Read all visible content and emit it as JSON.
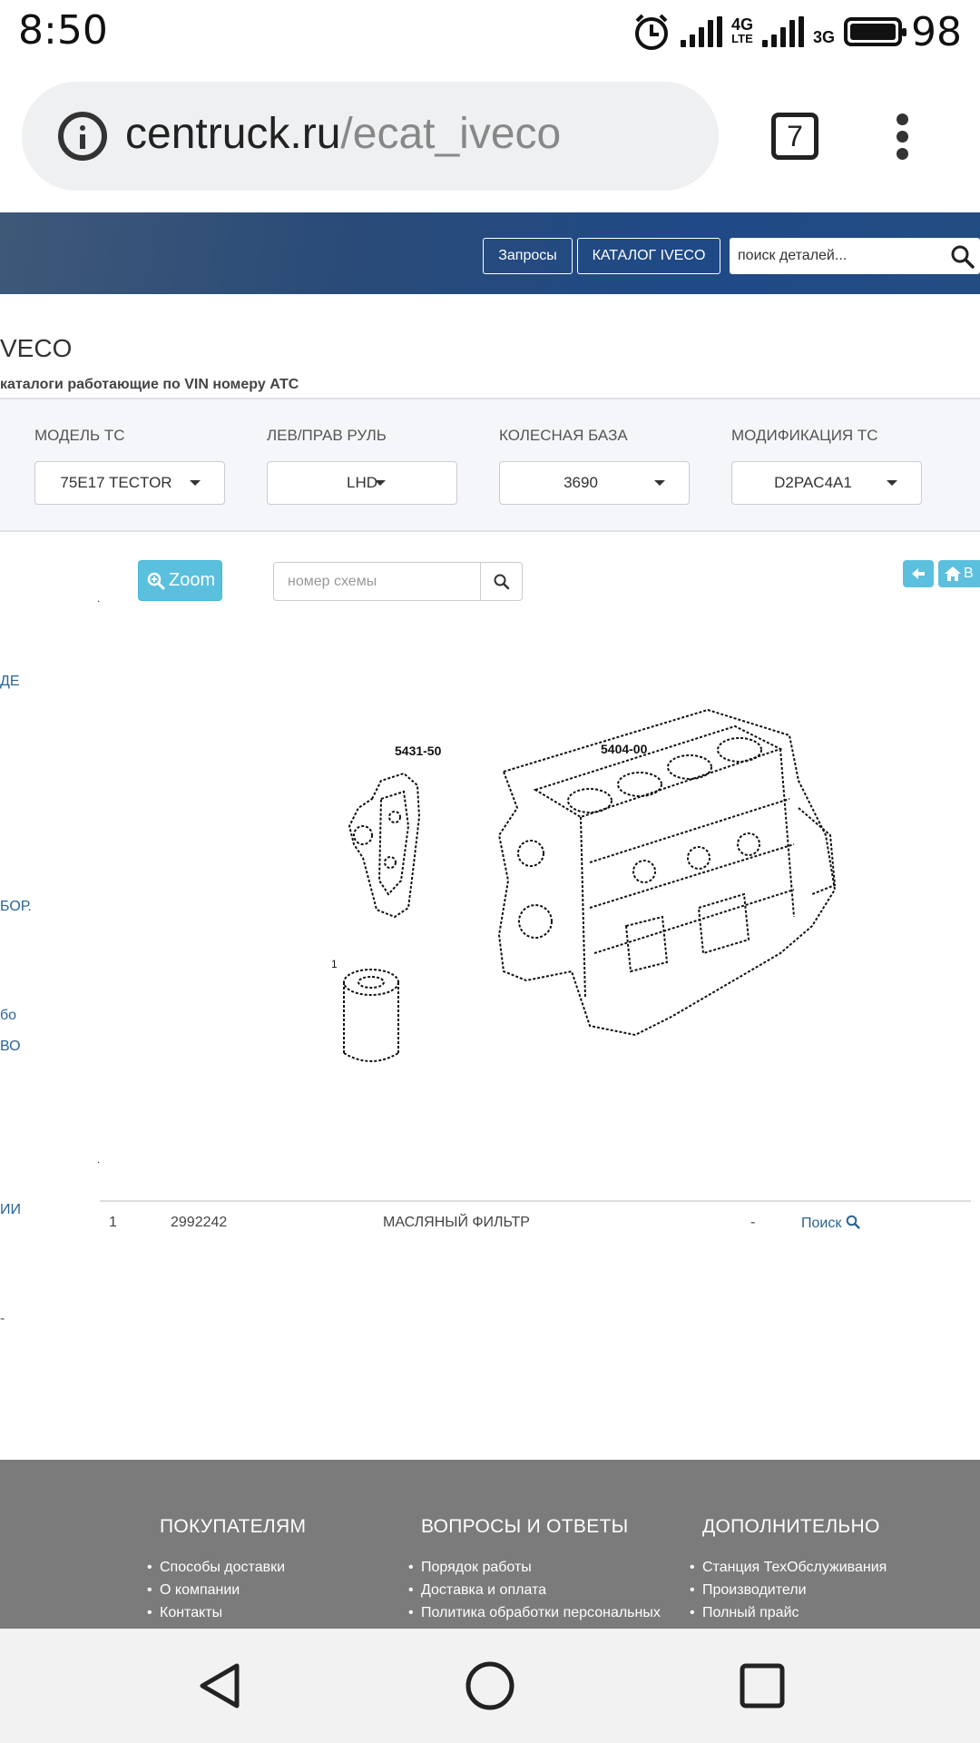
{
  "status_bar": {
    "time": "8:50",
    "net1": "4G",
    "net1_sub": "LTE",
    "net2": "3G",
    "battery": "98"
  },
  "browser": {
    "url_host": "centruck.ru",
    "url_path": "/ecat_iveco",
    "tab_count": "7"
  },
  "header": {
    "requests_label": "Запросы",
    "catalog_label": "КАТАЛОГ IVECO",
    "search_placeholder": "поиск деталей..."
  },
  "page": {
    "title": "VECO",
    "subtitle": "каталоги работающие по VIN номеру АТС"
  },
  "filters": [
    {
      "label": "МОДЕЛЬ ТС",
      "value": "75E17 TECTOR"
    },
    {
      "label": "ЛЕВ/ПРАВ РУЛЬ",
      "value": "LHD"
    },
    {
      "label": "КОЛЕСНАЯ БАЗА",
      "value": "3690"
    },
    {
      "label": "МОДИФИКАЦИЯ ТС",
      "value": "D2PAC4A1"
    }
  ],
  "tools": {
    "zoom_label": "Zoom",
    "scheme_placeholder": "номер схемы",
    "home_label": "В"
  },
  "sidebar_fragments": [
    "ДЕ",
    "БОР.",
    "бо",
    "ВО",
    "ИИ",
    "-"
  ],
  "diagram": {
    "label_left": "5431-50",
    "label_right": "5404-00",
    "callout": "1"
  },
  "parts": [
    {
      "num": "1",
      "code": "2992242",
      "name": "МАСЛЯНЫЙ ФИЛЬТР",
      "qty": "-",
      "action": "Поиск"
    }
  ],
  "footer": {
    "col1": {
      "title": "ПОКУПАТЕЛЯМ",
      "items": [
        "Способы доставки",
        "О компании",
        "Контакты"
      ]
    },
    "col2": {
      "title": "ВОПРОСЫ И ОТВЕТЫ",
      "items": [
        "Порядок работы",
        "Доставка и оплата",
        "Политика обработки персональных"
      ]
    },
    "col3": {
      "title": "ДОПОЛНИТЕЛЬНО",
      "items": [
        "Станция ТехОбслуживания",
        "Производители",
        "Полный прайс"
      ]
    }
  }
}
